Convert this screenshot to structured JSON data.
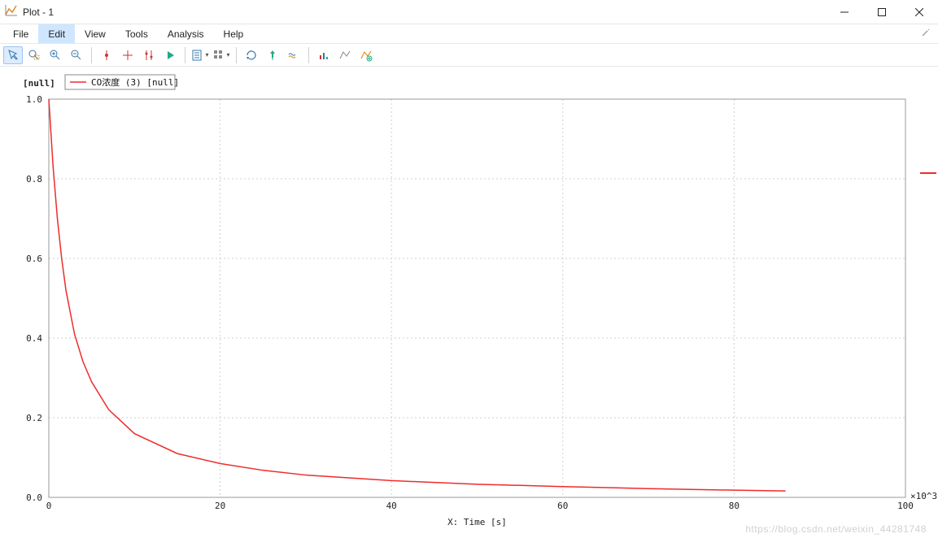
{
  "window": {
    "title": "Plot - 1"
  },
  "menubar": {
    "items": [
      "File",
      "Edit",
      "View",
      "Tools",
      "Analysis",
      "Help"
    ],
    "selected_index": 1
  },
  "toolbar": {
    "buttons": [
      "pointer",
      "zoom-in-rect",
      "zoom-in",
      "zoom-out",
      "sep",
      "pick-point",
      "crosshair",
      "multi-cursor",
      "play",
      "sep",
      "select-region",
      "grid-menu",
      "sep",
      "refresh",
      "pin",
      "layers",
      "sep",
      "bar-chart",
      "line-chart",
      "add-chart"
    ],
    "active_index": 0
  },
  "legend": {
    "label": "CO浓度 (3) [null]",
    "color": "#ef2b2b"
  },
  "axes": {
    "ylabel": "[null]",
    "xlabel": "X: Time [s]",
    "x_exponent": "×10^3"
  },
  "chart_data": {
    "type": "line",
    "title": "",
    "xlabel": "X: Time [s]",
    "ylabel": "[null]",
    "x_scale_note": "×10^3",
    "xlim": [
      0,
      100
    ],
    "ylim": [
      0.0,
      1.0
    ],
    "x_ticks": [
      0,
      20,
      40,
      60,
      80,
      100
    ],
    "y_ticks": [
      0.0,
      0.2,
      0.4,
      0.6,
      0.8,
      1.0
    ],
    "series": [
      {
        "name": "CO浓度 (3) [null]",
        "color": "#ef2b2b",
        "x": [
          0,
          0.5,
          1,
          1.5,
          2,
          3,
          4,
          5,
          7,
          10,
          15,
          20,
          25,
          30,
          40,
          50,
          60,
          70,
          80,
          86
        ],
        "y": [
          1.0,
          0.83,
          0.7,
          0.6,
          0.52,
          0.41,
          0.34,
          0.29,
          0.22,
          0.16,
          0.11,
          0.085,
          0.068,
          0.056,
          0.042,
          0.033,
          0.027,
          0.022,
          0.018,
          0.016
        ]
      }
    ]
  },
  "watermark": "https://blog.csdn.net/weixin_44281748"
}
